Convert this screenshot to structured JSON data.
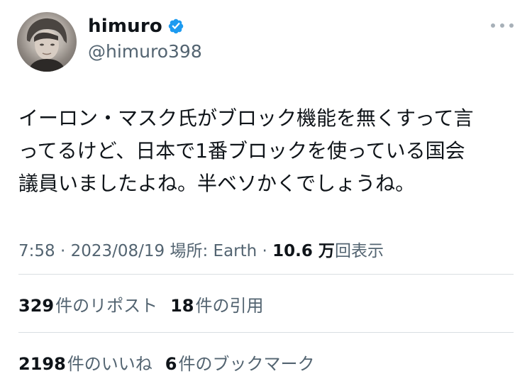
{
  "author": {
    "display_name": "himuro",
    "handle": "@himuro398",
    "avatar_icon": "user-photo",
    "verified_icon": "verified-badge-icon",
    "verified_color": "#1d9bf0"
  },
  "more_icon": "more-options-icon",
  "tweet": {
    "text": "イーロン・マスク氏がブロック機能を無くすって言\nってるけど、日本で1番ブロックを使っている国会\n議員いましたよね。半ベソかくでしょうね。"
  },
  "meta": {
    "time": "7:58",
    "sep1": " · ",
    "date": "2023/08/19",
    "location": " 場所: Earth",
    "sep2": " · ",
    "views_count": "10.6 万",
    "views_label": "回表示"
  },
  "stats": {
    "reposts": {
      "count": "329",
      "label": "件のリポスト"
    },
    "quotes": {
      "count": "18",
      "label": "件の引用"
    },
    "likes": {
      "count": "2198",
      "label": "件のいいね"
    },
    "bookmarks": {
      "count": "6",
      "label": "件のブックマーク"
    }
  },
  "colors": {
    "text_primary": "#0f1419",
    "text_secondary": "#536471",
    "divider": "#d9dee2"
  }
}
